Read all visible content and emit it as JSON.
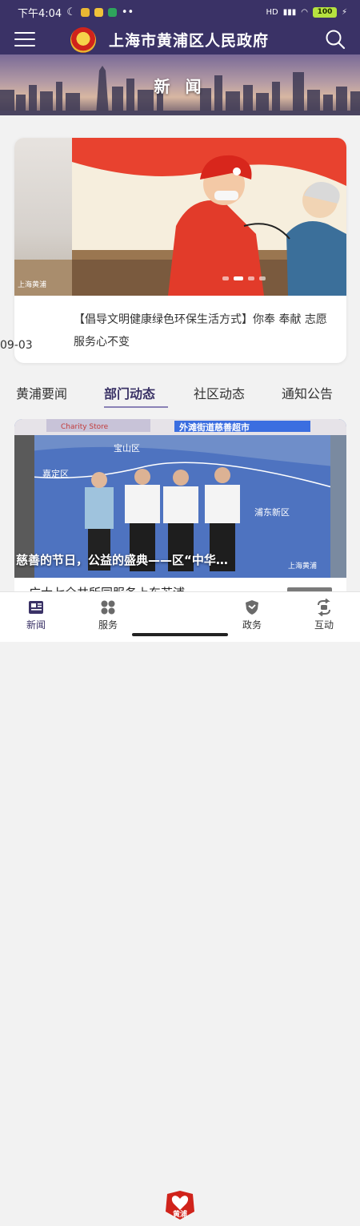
{
  "status_bar": {
    "time": "下午4:04",
    "dots": "••",
    "network": "HD",
    "battery": "100"
  },
  "header": {
    "title": "上海市黄浦区人民政府"
  },
  "banner": {
    "title": "新 闻"
  },
  "featured": {
    "date": "09-03",
    "caption": "【倡导文明健康绿色环保生活方式】你奉 奉献 志愿服务心不变",
    "watermark": "上海黄浦",
    "slide_count": 4,
    "active_slide": 1
  },
  "tabs": [
    {
      "label": "黄浦要闻",
      "active": false
    },
    {
      "label": "部门动态",
      "active": true
    },
    {
      "label": "社区动态",
      "active": false
    },
    {
      "label": "通知公告",
      "active": false
    }
  ],
  "news_card": {
    "title": "慈善的节日，公益的盛典——区“中华…",
    "watermark": "上海黄浦",
    "sign_text": "外滩街道慈善超市",
    "store_text": "Charity Store",
    "map_labels": [
      "宝山区",
      "嘉定区",
      "浦东新区"
    ]
  },
  "next_item": {
    "text": "广大七全共所同服务上东苏浦"
  },
  "bottom_nav": [
    {
      "label": "新闻",
      "icon": "news-icon",
      "active": true
    },
    {
      "label": "服务",
      "icon": "service-grid-icon",
      "active": false
    },
    {
      "label": "政务",
      "icon": "gov-shield-icon",
      "active": false
    },
    {
      "label": "互动",
      "icon": "interaction-icon",
      "active": false
    }
  ],
  "center_logo_text": "黄浦",
  "colors": {
    "header_bg": "#3a3266",
    "active_tab": "#3a3266",
    "accent_red": "#d0231b"
  }
}
